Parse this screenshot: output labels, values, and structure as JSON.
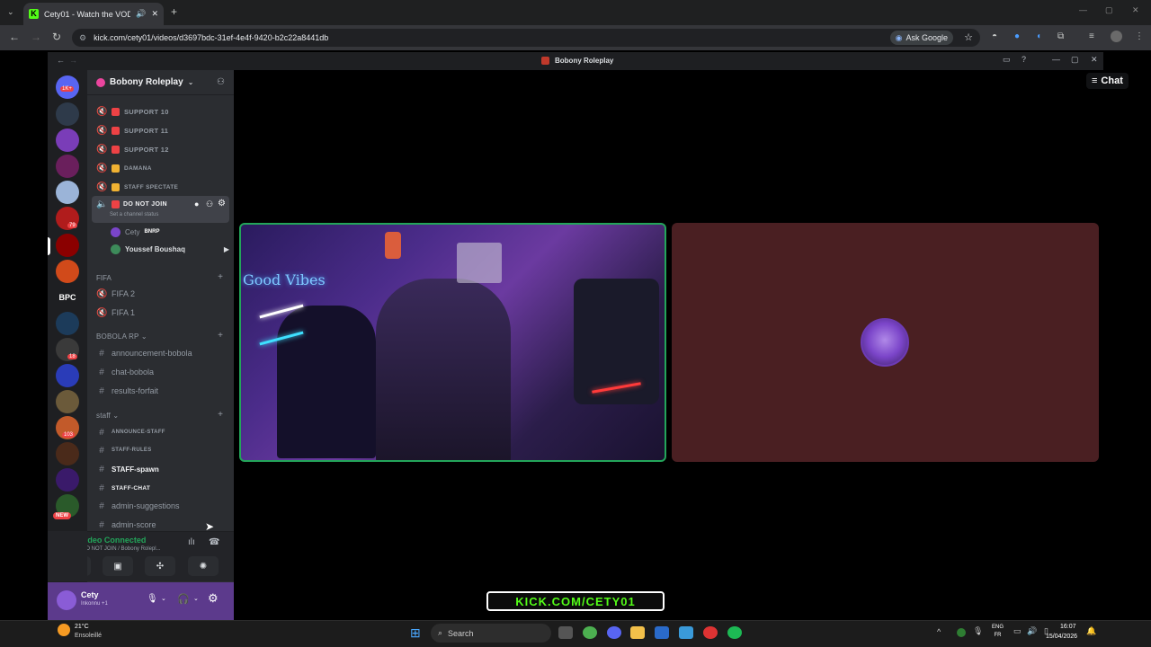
{
  "browser": {
    "tab_title": "Cety01 - Watch the VOD o",
    "url": "kick.com/cety01/videos/d3697bdc-31ef-4e4f-9420-b2c22a8441db",
    "ask_google": "Ask Google"
  },
  "discord": {
    "window_title": "Bobony Roleplay",
    "server_name": "Bobony Roleplay",
    "server_badges": [
      "1K+",
      "79",
      "BPC",
      "18",
      "103",
      "NEW"
    ],
    "voice_channels": [
      {
        "name": "SUPPORT 10"
      },
      {
        "name": "SUPPORT 11"
      },
      {
        "name": "SUPPORT 12"
      },
      {
        "name": "DAMANA"
      },
      {
        "name": "STAFF SPECTATE"
      },
      {
        "name": "DO NOT JOIN",
        "status": "Set a channel status"
      }
    ],
    "voice_members": [
      {
        "name": "Cety",
        "tag": "BNRP"
      },
      {
        "name": "Youssef Boushaq"
      }
    ],
    "fifa_header": "FIFA",
    "fifa_channels": [
      "FIFA 2",
      "FIFA 1"
    ],
    "cat_bobola": "BOBOLA RP",
    "bobola_channels": [
      "announcement-bobola",
      "chat-bobola",
      "results-forfait"
    ],
    "cat_staff": "staff",
    "staff_channels": [
      "ANNOUNCE-STAFF",
      "STAFF-RULES",
      "STAFF-spawn",
      "STAFF-CHAT",
      "admin-suggestions",
      "admin-score"
    ],
    "voice_status": "Video Connected",
    "voice_location": "DO NOT JOIN / Bobony Rolepl...",
    "user_name": "Cety",
    "user_status": "Inkonnu +1",
    "chat_button": "Chat"
  },
  "stream": {
    "overlay_text": "KICK.COM/CETY01",
    "neon_sign": "Good Vibes"
  },
  "taskbar": {
    "weather_temp": "21°C",
    "weather_desc": "Ensoleillé",
    "search_placeholder": "Search",
    "lang": "ENG",
    "lang_sub": "FR",
    "time": "16:07",
    "date": "15/04/2026"
  },
  "colors": {
    "kick_green": "#53fc18",
    "discord_sidebar": "#2b2d31",
    "voice_green": "#23a55a"
  }
}
